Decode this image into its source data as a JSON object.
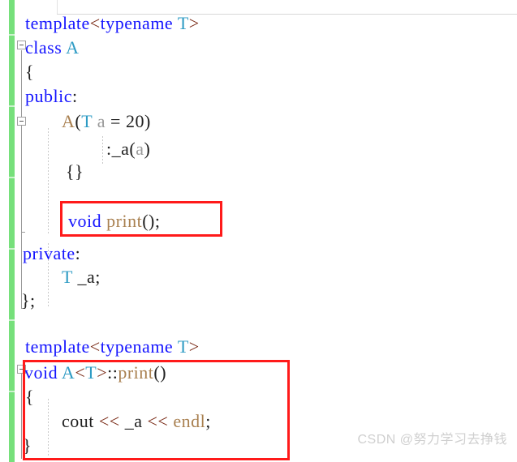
{
  "app": {
    "kind": "code-editor",
    "language": "C++",
    "background": "#ffffff",
    "watermark": "CSDN @努力学习去挣钱"
  },
  "colors": {
    "keyword": "#1414ff",
    "type": "#2e9bc4",
    "operator": "#7a2b17",
    "function": "#a98050",
    "parameter": "#9a9a9a",
    "plain": "#202020",
    "change_bar": "#76e07b",
    "highlight_box": "#ff1a1a",
    "watermark": "#cfcfcf"
  },
  "gutter": {
    "change_bar_label": "modified-lines-indicator",
    "fold_markers": [
      {
        "name": "fold-class-a",
        "state": "expanded",
        "glyph": "−"
      },
      {
        "name": "fold-constructor",
        "state": "expanded",
        "glyph": "−"
      },
      {
        "name": "fold-print-definition",
        "state": "expanded",
        "glyph": "−"
      }
    ]
  },
  "code": {
    "lines": [
      {
        "id": "line-template-1",
        "text": "template<typename T>",
        "tokens": [
          {
            "t": "template",
            "c": "kw"
          },
          {
            "t": "<",
            "c": "op"
          },
          {
            "t": "typename",
            "c": "kw"
          },
          {
            "t": " ",
            "c": "plain"
          },
          {
            "t": "T",
            "c": "type"
          },
          {
            "t": ">",
            "c": "op"
          }
        ]
      },
      {
        "id": "line-class-a",
        "text": "class A",
        "tokens": [
          {
            "t": "class",
            "c": "kw"
          },
          {
            "t": " ",
            "c": "plain"
          },
          {
            "t": "A",
            "c": "type"
          }
        ]
      },
      {
        "id": "line-open-brace-class",
        "text": "{",
        "tokens": [
          {
            "t": "{",
            "c": "brace"
          }
        ]
      },
      {
        "id": "line-public",
        "text": "public:",
        "tokens": [
          {
            "t": "public",
            "c": "kw"
          },
          {
            "t": ":",
            "c": "plain"
          }
        ]
      },
      {
        "id": "line-ctor",
        "text": "A(T a = 20)",
        "tokens": [
          {
            "t": "A",
            "c": "fn"
          },
          {
            "t": "(",
            "c": "plain"
          },
          {
            "t": "T",
            "c": "type"
          },
          {
            "t": " ",
            "c": "plain"
          },
          {
            "t": "a",
            "c": "param"
          },
          {
            "t": " = 20)",
            "c": "plain"
          }
        ]
      },
      {
        "id": "line-init-list",
        "text": ":_a(a)",
        "tokens": [
          {
            "t": ":_a(",
            "c": "plain"
          },
          {
            "t": "a",
            "c": "param"
          },
          {
            "t": ")",
            "c": "plain"
          }
        ]
      },
      {
        "id": "line-ctor-body",
        "text": "{}",
        "tokens": [
          {
            "t": "{}",
            "c": "brace"
          }
        ]
      },
      {
        "id": "line-void-print-decl",
        "text": "void print();",
        "highlighted": true,
        "tokens": [
          {
            "t": "void",
            "c": "kw"
          },
          {
            "t": " ",
            "c": "plain"
          },
          {
            "t": "print",
            "c": "fn"
          },
          {
            "t": "();",
            "c": "plain"
          }
        ]
      },
      {
        "id": "line-private",
        "text": "private:",
        "tokens": [
          {
            "t": "private",
            "c": "kw"
          },
          {
            "t": ":",
            "c": "plain"
          }
        ]
      },
      {
        "id": "line-member-a",
        "text": "T _a;",
        "tokens": [
          {
            "t": "T",
            "c": "type"
          },
          {
            "t": " _a;",
            "c": "plain"
          }
        ]
      },
      {
        "id": "line-close-class",
        "text": "};",
        "tokens": [
          {
            "t": "};",
            "c": "brace"
          }
        ]
      },
      {
        "id": "line-template-2",
        "text": "template<typename T>",
        "tokens": [
          {
            "t": "template",
            "c": "kw"
          },
          {
            "t": "<",
            "c": "op"
          },
          {
            "t": "typename",
            "c": "kw"
          },
          {
            "t": " ",
            "c": "plain"
          },
          {
            "t": "T",
            "c": "type"
          },
          {
            "t": ">",
            "c": "op"
          }
        ]
      },
      {
        "id": "line-print-definition",
        "text": "void A<T>::print()",
        "highlighted": true,
        "tokens": [
          {
            "t": "void",
            "c": "kw"
          },
          {
            "t": " ",
            "c": "plain"
          },
          {
            "t": "A",
            "c": "type"
          },
          {
            "t": "<",
            "c": "op"
          },
          {
            "t": "T",
            "c": "type"
          },
          {
            "t": ">",
            "c": "op"
          },
          {
            "t": "::",
            "c": "plain"
          },
          {
            "t": "print",
            "c": "fn"
          },
          {
            "t": "()",
            "c": "plain"
          }
        ]
      },
      {
        "id": "line-open-brace-print",
        "text": "{",
        "highlighted": true,
        "tokens": [
          {
            "t": "{",
            "c": "brace"
          }
        ]
      },
      {
        "id": "line-cout",
        "text": "cout << _a << endl;",
        "highlighted": true,
        "tokens": [
          {
            "t": "cout",
            "c": "plain"
          },
          {
            "t": " ",
            "c": "plain"
          },
          {
            "t": "<<",
            "c": "op"
          },
          {
            "t": " _a ",
            "c": "plain"
          },
          {
            "t": "<<",
            "c": "op"
          },
          {
            "t": " ",
            "c": "plain"
          },
          {
            "t": "endl",
            "c": "fn"
          },
          {
            "t": ";",
            "c": "plain"
          }
        ]
      },
      {
        "id": "line-close-brace-print",
        "text": "}",
        "highlighted": true,
        "tokens": [
          {
            "t": "}",
            "c": "brace"
          }
        ]
      }
    ]
  },
  "annotations": [
    {
      "id": "highlight-void-print-decl",
      "label": "red-box-around-print-declaration"
    },
    {
      "id": "highlight-print-definition",
      "label": "red-box-around-print-definition"
    }
  ]
}
